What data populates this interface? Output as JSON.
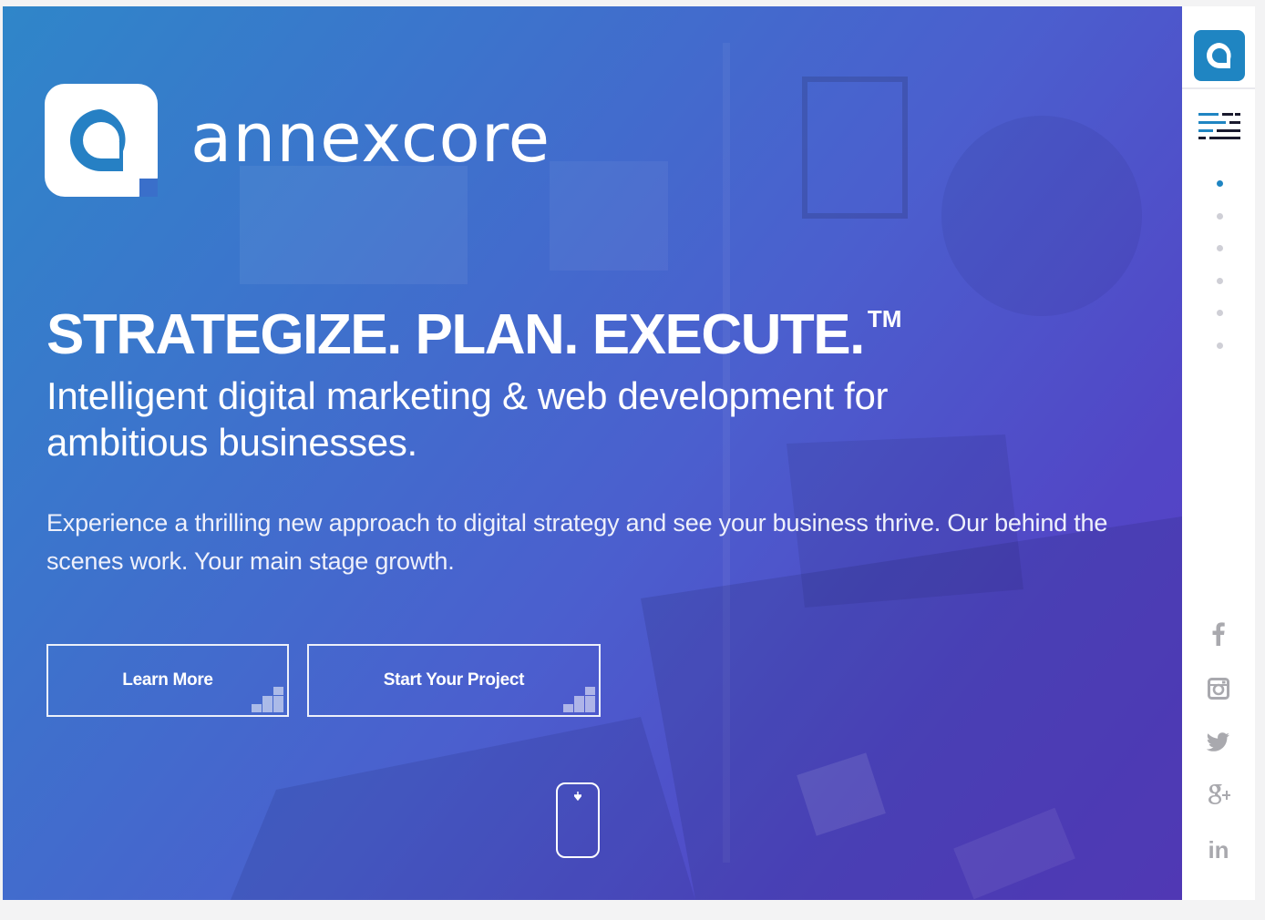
{
  "brand": {
    "name_part1": "annex",
    "name_part2": "core"
  },
  "hero": {
    "headline": "STRATEGIZE. PLAN. EXECUTE.",
    "trademark": "TM",
    "subheadline": "Intelligent digital marketing & web development for ambitious businesses.",
    "description": "Experience a thrilling new approach to digital strategy and see your business thrive. Our behind the scenes work. Your main stage growth."
  },
  "buttons": {
    "learn_more": "Learn More",
    "start_project": "Start Your Project"
  },
  "rail": {
    "section_dots": 6,
    "active_section": 1,
    "social": [
      "facebook-icon",
      "instagram-icon",
      "twitter-icon",
      "google-plus-icon",
      "linkedin-icon"
    ],
    "linkedin_label": "in"
  },
  "colors": {
    "gradient_start": "#2f86c9",
    "gradient_end": "#5a3ec6",
    "accent": "#1f85c2",
    "rail_bg": "#ffffff",
    "social_icon": "#a9a9ae"
  }
}
